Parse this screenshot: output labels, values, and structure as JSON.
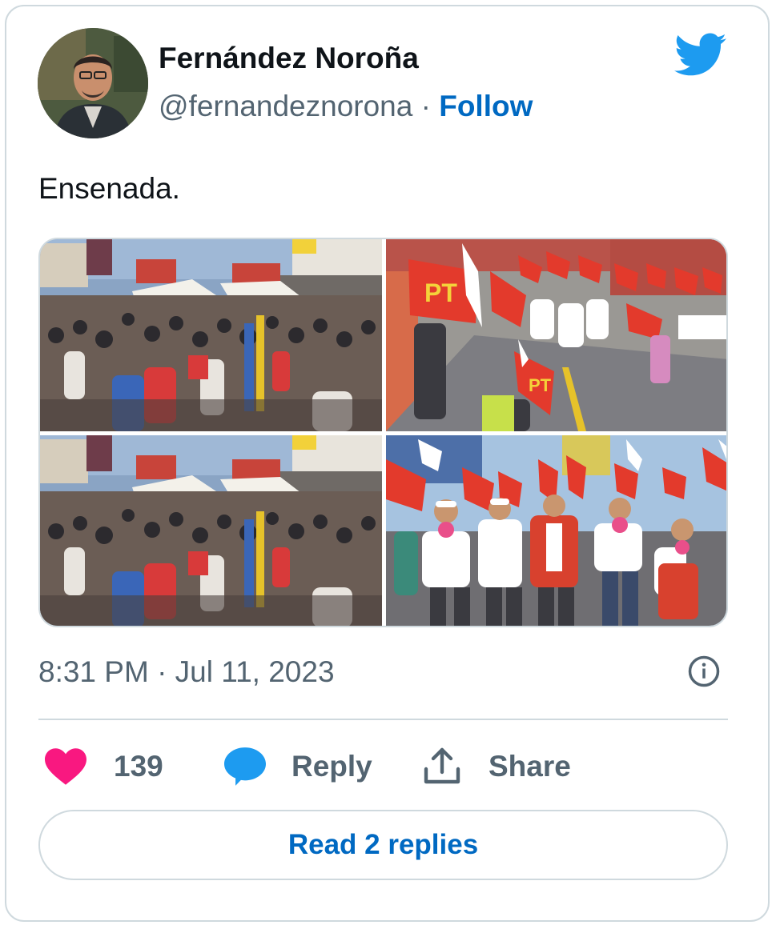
{
  "author": {
    "name": "Fernández Noroña",
    "handle": "@fernandeznorona",
    "separator": "·",
    "follow_label": "Follow",
    "avatar_icon": "user-avatar-photo"
  },
  "brand": {
    "icon": "twitter-bird-icon",
    "color": "#1d9bf0"
  },
  "tweet": {
    "text": "Ensenada.",
    "timestamp": "8:31 PM · Jul 11, 2023"
  },
  "media": {
    "photo_count": 4,
    "photos": [
      {
        "name": "crowd-street-photo"
      },
      {
        "name": "flag-march-photo"
      },
      {
        "name": "crowd-street-photo-duplicate"
      },
      {
        "name": "leaders-march-photo"
      }
    ],
    "flag_text": "PT"
  },
  "actions": {
    "like_count": "139",
    "reply_label": "Reply",
    "share_label": "Share"
  },
  "read_replies_label": "Read 2 replies",
  "colors": {
    "text_primary": "#0f1419",
    "text_secondary": "#536471",
    "link": "#0069c2",
    "like": "#f91880",
    "reply": "#1d9bf0",
    "border": "#cfd9de"
  }
}
